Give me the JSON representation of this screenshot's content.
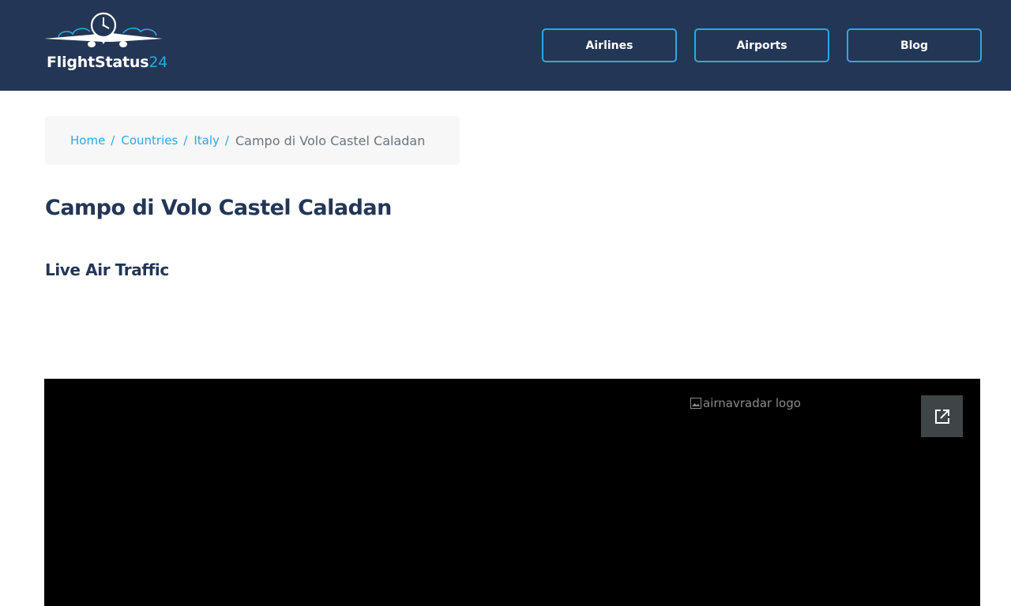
{
  "header": {
    "logo": {
      "name": "FlightStatus",
      "accent": "24",
      "icon": "airplane-clock-logo"
    },
    "nav": [
      {
        "label": "Airlines"
      },
      {
        "label": "Airports"
      },
      {
        "label": "Blog"
      }
    ]
  },
  "breadcrumb": {
    "items": [
      {
        "label": "Home"
      },
      {
        "label": "Countries"
      },
      {
        "label": "Italy"
      }
    ],
    "separator": "/",
    "current": "Campo di Volo Castel Caladan"
  },
  "page": {
    "title": "Campo di Volo Castel Caladan",
    "section_title": "Live Air Traffic"
  },
  "radar": {
    "logo_alt": "airnavradar logo",
    "open_icon": "open-in-new-icon"
  },
  "colors": {
    "header_bg": "#233656",
    "accent": "#2ea8e0",
    "title": "#233656",
    "breadcrumb_bg": "#f7f7f7",
    "radar_bg": "#000000"
  }
}
